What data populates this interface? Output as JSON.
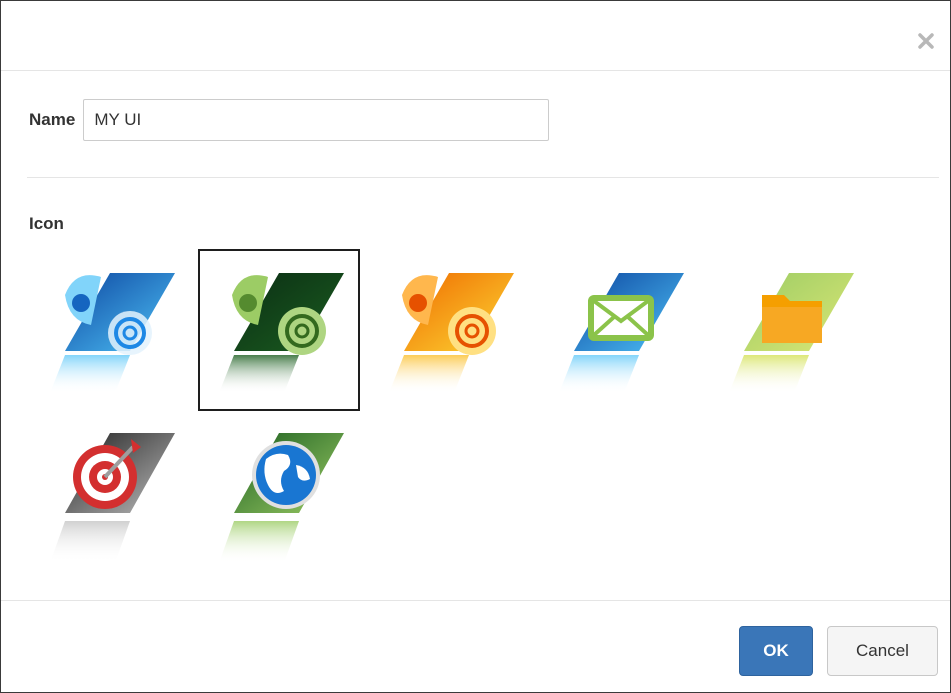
{
  "dialog": {
    "close_icon": "close-icon"
  },
  "name_field": {
    "label": "Name",
    "value": "MY UI"
  },
  "icon_section": {
    "label": "Icon",
    "selected": "green-shell",
    "icons": [
      {
        "id": "blue-shell",
        "icon": "blue-shell-icon",
        "colors": [
          "#1565c0",
          "#42a5f5"
        ]
      },
      {
        "id": "green-shell",
        "icon": "green-shell-icon",
        "colors": [
          "#0d3d1a",
          "#7cb342"
        ]
      },
      {
        "id": "orange-shell",
        "icon": "orange-shell-icon",
        "colors": [
          "#ef6c00",
          "#fdd835"
        ]
      },
      {
        "id": "mail",
        "icon": "envelope-icon",
        "colors": [
          "#1565c0",
          "#8bc34a"
        ]
      },
      {
        "id": "folder",
        "icon": "folder-icon",
        "colors": [
          "#8bc34a",
          "#f9a825"
        ]
      },
      {
        "id": "target",
        "icon": "target-icon",
        "colors": [
          "#424242",
          "#d32f2f"
        ]
      },
      {
        "id": "globe",
        "icon": "globe-icon",
        "colors": [
          "#2e7d32",
          "#1976d2"
        ]
      }
    ]
  },
  "footer": {
    "ok_label": "OK",
    "cancel_label": "Cancel"
  },
  "colors": {
    "primary_button": "#3a76b8",
    "selected_border": "#1e1e1e",
    "divider": "#e5e5e5"
  }
}
